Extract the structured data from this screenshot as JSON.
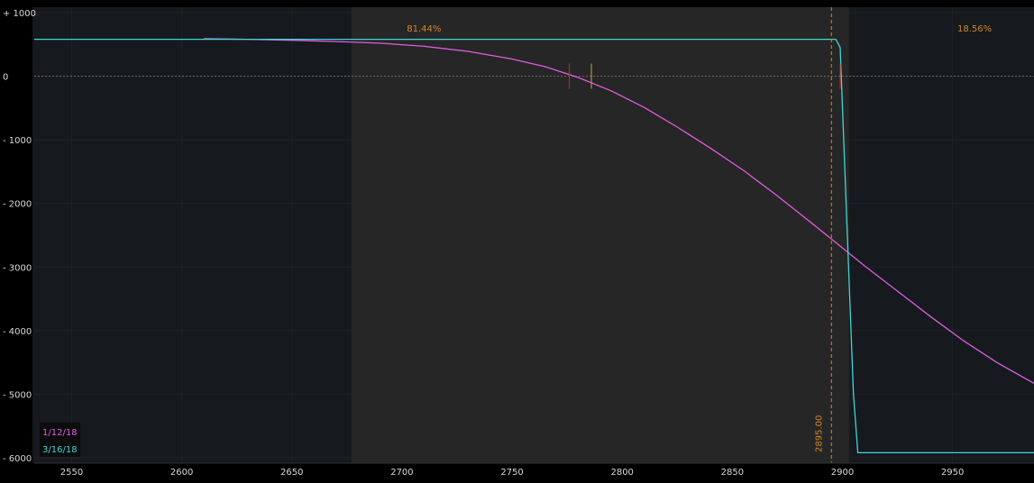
{
  "chart_data": {
    "type": "line",
    "x_ticks": [
      2550,
      2600,
      2650,
      2700,
      2750,
      2800,
      2850,
      2900,
      2950
    ],
    "y_ticks": [
      1000,
      0,
      -1000,
      -2000,
      -3000,
      -4000,
      -5000,
      -6000
    ],
    "y_tick_labels": [
      "+ 1000",
      "0",
      "- 1000",
      "- 2000",
      "- 3000",
      "- 4000",
      "- 5000",
      "- 6000"
    ],
    "xlim": [
      2533,
      2987
    ],
    "ylim": [
      -6000,
      1000
    ],
    "series": [
      {
        "name": "1/12/18",
        "color": "#e05ce0",
        "x": [
          2610,
          2630,
          2650,
          2670,
          2690,
          2710,
          2730,
          2750,
          2765,
          2780,
          2795,
          2810,
          2825,
          2840,
          2855,
          2870,
          2885,
          2895,
          2910,
          2925,
          2940,
          2955,
          2970,
          2987
        ],
        "y": [
          590,
          580,
          565,
          545,
          520,
          470,
          390,
          270,
          150,
          -20,
          -230,
          -490,
          -800,
          -1130,
          -1480,
          -1870,
          -2280,
          -2560,
          -2980,
          -3380,
          -3780,
          -4160,
          -4500,
          -4830
        ]
      },
      {
        "name": "3/16/18",
        "color": "#3fd6d6",
        "x": [
          2533,
          2897,
          2899,
          2905,
          2907,
          2987
        ],
        "y": [
          580,
          580,
          450,
          -5000,
          -5920,
          -5920
        ]
      }
    ],
    "shaded_range": [
      2677,
      2903
    ],
    "probability_labels": [
      {
        "text": "81.44%",
        "x": 2710
      },
      {
        "text": "18.56%",
        "x": 2960
      }
    ],
    "vertical_line": {
      "x": 2895,
      "label": "2895.00",
      "color": "#d2862a"
    },
    "markers": [
      {
        "x": 2776,
        "color": "#e02020"
      },
      {
        "x": 2786,
        "color": "#c8a050"
      },
      {
        "x": 2899,
        "color": "#e02020"
      }
    ],
    "zero_line": true,
    "legend_position": "bottom-left"
  }
}
